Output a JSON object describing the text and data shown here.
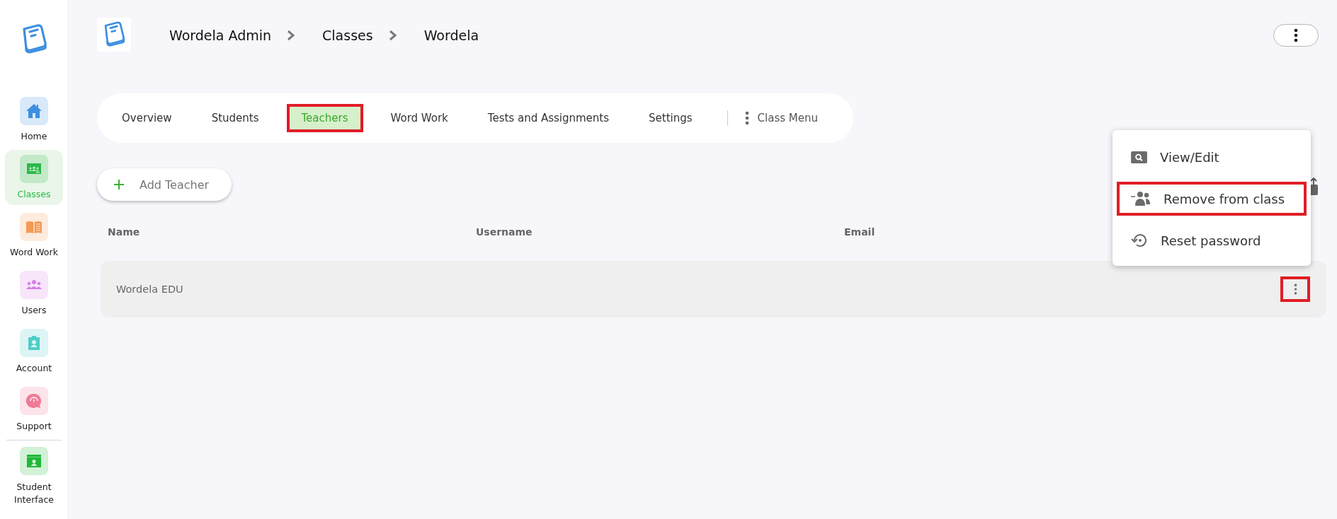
{
  "sidebar": {
    "items": [
      {
        "label": "Home",
        "selected": false,
        "color": "#3d8fe0"
      },
      {
        "label": "Classes",
        "selected": true,
        "color": "#2db84a"
      },
      {
        "label": "Word Work",
        "selected": false,
        "color": "#f59a55"
      },
      {
        "label": "Users",
        "selected": false,
        "color": "#d57ee8"
      },
      {
        "label": "Account",
        "selected": false,
        "color": "#4ecdc6"
      },
      {
        "label": "Support",
        "selected": false,
        "color": "#f07a95"
      }
    ],
    "bottom_item": {
      "label": "Student Interface",
      "selected": false,
      "color": "#20b838"
    }
  },
  "breadcrumb": [
    "Wordela Admin",
    "Classes",
    "Wordela"
  ],
  "tabs": [
    {
      "label": "Overview",
      "selected": false,
      "highlighted": false
    },
    {
      "label": "Students",
      "selected": false,
      "highlighted": false
    },
    {
      "label": "Teachers",
      "selected": true,
      "highlighted": true
    },
    {
      "label": "Word Work",
      "selected": false,
      "highlighted": false
    },
    {
      "label": "Tests and Assignments",
      "selected": false,
      "highlighted": false
    },
    {
      "label": "Settings",
      "selected": false,
      "highlighted": false
    }
  ],
  "class_menu": {
    "label": "Class Menu"
  },
  "add_button": {
    "label": "Add Teacher"
  },
  "table": {
    "columns": [
      "Name",
      "Username",
      "Email"
    ],
    "rows": [
      {
        "cells": [
          "Wordela EDU",
          "",
          ""
        ],
        "menu_highlighted": true
      }
    ]
  },
  "row_menu": {
    "items": [
      {
        "label": "View/Edit",
        "highlighted": false
      },
      {
        "label": "Remove from class",
        "highlighted": true
      },
      {
        "label": "Reset password",
        "highlighted": false
      }
    ]
  }
}
